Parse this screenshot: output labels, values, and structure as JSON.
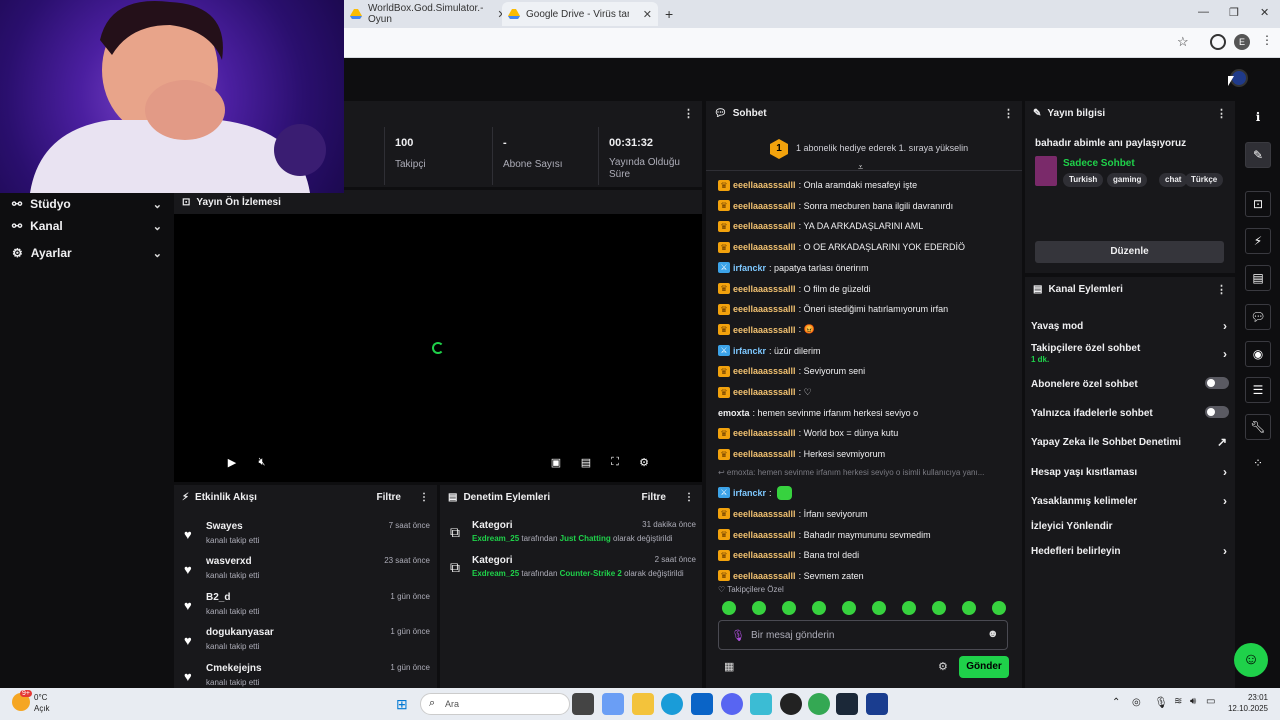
{
  "browser": {
    "tabs": [
      {
        "title": "WorldBox.God.Simulator.-Oyun"
      },
      {
        "title": "Google Drive - Virüs taraması"
      }
    ]
  },
  "stats": [
    {
      "value": "100",
      "label": "Takipçi"
    },
    {
      "value": "-",
      "label": "Abone Sayısı"
    },
    {
      "value": "00:31:32",
      "label": "Yayında Olduğu Süre"
    }
  ],
  "sidebar": {
    "items": [
      {
        "label": "Stüdyo"
      },
      {
        "label": "Kanal"
      },
      {
        "label": "Ayarlar"
      }
    ]
  },
  "preview": {
    "title": "Yayın Ön İzlemesi"
  },
  "activity": {
    "title": "Etkinlik Akışı",
    "filter": "Filtre",
    "items": [
      {
        "name": "Swayes",
        "sub": "kanalı takip etti",
        "time": "7 saat önce"
      },
      {
        "name": "wasverxd",
        "sub": "kanalı takip etti",
        "time": "23 saat önce"
      },
      {
        "name": "B2_d",
        "sub": "kanalı takip etti",
        "time": "1 gün önce"
      },
      {
        "name": "dogukanyasar",
        "sub": "kanalı takip etti",
        "time": "1 gün önce"
      },
      {
        "name": "Cmekejejns",
        "sub": "kanalı takip etti",
        "time": "1 gün önce"
      }
    ]
  },
  "modlog": {
    "title": "Denetim Eylemleri",
    "filter": "Filtre",
    "items": [
      {
        "title": "Kategori",
        "time": "31 dakika önce",
        "user": "Exdream_25",
        "mid": " tarafından ",
        "cat": "Just Chatting",
        "end": " olarak değiştirildi"
      },
      {
        "title": "Kategori",
        "time": "2 saat önce",
        "user": "Exdream_25",
        "mid": " tarafından ",
        "cat": "Counter-Strike 2",
        "end": " olarak değiştirildi"
      }
    ]
  },
  "chat": {
    "title": "Sohbet",
    "hype_number": "1",
    "hype_text": "1 abonelik hediye ederek 1. sıraya yükselin",
    "messages": [
      {
        "user": "eeellaaasssalll",
        "text": ": Onla aramdaki mesafeyi işte",
        "badge": "gold",
        "ucolor": "gold"
      },
      {
        "user": "eeellaaasssalll",
        "text": ": Sonra mecburen bana ilgili davranırdı",
        "badge": "gold",
        "ucolor": "gold"
      },
      {
        "user": "eeellaaasssalll",
        "text": ": YA DA ARKADAŞLARINI AML",
        "badge": "gold",
        "ucolor": "gold"
      },
      {
        "user": "eeellaaasssalll",
        "text": ": O OE ARKADAŞLARINI YOK EDERDİÖ",
        "badge": "gold",
        "ucolor": "gold"
      },
      {
        "user": "irfanckr",
        "text": ": papatya tarlası önerirım",
        "badge": "blue",
        "ucolor": "blue"
      },
      {
        "user": "eeellaaasssalll",
        "text": ": O film de güzeldi",
        "badge": "gold",
        "ucolor": "gold"
      },
      {
        "user": "eeellaaasssalll",
        "text": ": Öneri istediğimi hatırlamıyorum irfan",
        "badge": "gold",
        "ucolor": "gold"
      },
      {
        "user": "eeellaaasssalll",
        "text": ": 😡",
        "badge": "gold",
        "ucolor": "gold"
      },
      {
        "user": "irfanckr",
        "text": ": üzür dilerim",
        "badge": "blue",
        "ucolor": "blue"
      },
      {
        "user": "eeellaaasssalll",
        "text": ": Seviyorum seni",
        "badge": "gold",
        "ucolor": "gold"
      },
      {
        "user": "eeellaaasssalll",
        "text": ": ♡",
        "badge": "gold",
        "ucolor": "gold"
      },
      {
        "user": "emoxta",
        "text": ": hemen sevinme irfanım herkesi seviyo o",
        "badge": "none",
        "ucolor": "white"
      },
      {
        "user": "eeellaaasssalll",
        "text": ": World box = dünya kutu",
        "badge": "gold",
        "ucolor": "gold"
      },
      {
        "user": "eeellaaasssalll",
        "text": ": Herkesi sevmiyorum",
        "badge": "gold",
        "ucolor": "gold"
      }
    ],
    "reply_ref": "↩ emoxta: hemen sevinme irfanım herkesi seviyo o isimli kullanıcıya yanı...",
    "messages2": [
      {
        "user": "irfanckr",
        "text": ":",
        "badge": "blue",
        "ucolor": "blue"
      },
      {
        "user": "eeellaaasssalll",
        "text": ": İrfanı seviyorum",
        "badge": "gold",
        "ucolor": "gold"
      },
      {
        "user": "eeellaaasssalll",
        "text": ": Bahadır maymununu sevmedim",
        "badge": "gold",
        "ucolor": "gold"
      },
      {
        "user": "eeellaaasssalll",
        "text": ": Bana trol dedi",
        "badge": "gold",
        "ucolor": "gold"
      },
      {
        "user": "eeellaaasssalll",
        "text": ": Sevmem zaten",
        "badge": "gold",
        "ucolor": "gold"
      }
    ],
    "followers_only": "♡ Takipçilere Özel",
    "input_placeholder": "Bir mesaj gönderin",
    "send_label": "Gönder"
  },
  "info": {
    "title": "Yayın bilgisi",
    "stream_title": "bahadır abimle anı paylaşıyoruz",
    "category": "Sadece Sohbet",
    "tags": [
      "Turkish",
      "gaming",
      "chat",
      "Türkçe"
    ],
    "edit_label": "Düzenle"
  },
  "channel_actions": {
    "title": "Kanal Eylemleri",
    "rows": [
      {
        "label": "Yavaş mod",
        "kind": "chevron"
      },
      {
        "label": "Takipçilere özel sohbet",
        "sub": "1 dk.",
        "kind": "chevron"
      },
      {
        "label": "Abonelere özel sohbet",
        "kind": "toggle"
      },
      {
        "label": "Yalnızca ifadelerle sohbet",
        "kind": "toggle"
      },
      {
        "label": "Yapay Zeka ile Sohbet Denetimi",
        "kind": "external"
      },
      {
        "label": "Hesap yaşı kısıtlaması",
        "kind": "chevron"
      },
      {
        "label": "Yasaklanmış kelimeler",
        "kind": "chevron"
      },
      {
        "label": "İzleyici Yönlendir",
        "kind": "none"
      },
      {
        "label": "Hedefleri belirleyin",
        "kind": "chevron"
      }
    ]
  },
  "taskbar": {
    "weather_temp": "0°C",
    "weather_text": "Açık",
    "weather_badge": "9+",
    "search_placeholder": "Ara",
    "time": "23:01",
    "date": "12.10.2025"
  },
  "colors": {
    "accent": "#1fd14a",
    "panel": "#18181b",
    "bg": "#0e0e10",
    "sub_badge": "#f2a20d"
  }
}
